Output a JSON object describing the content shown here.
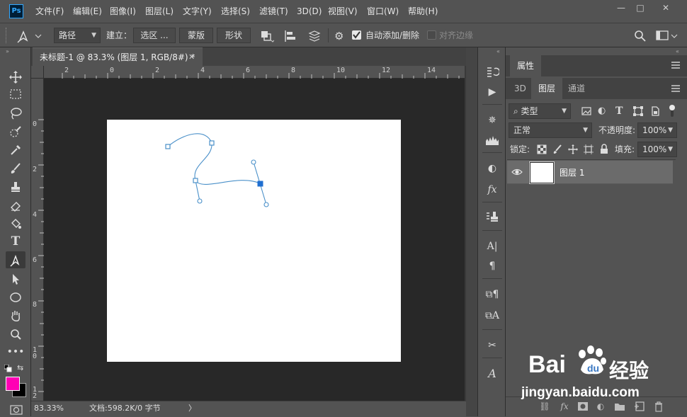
{
  "menubar": {
    "app_icon": "Ps",
    "items": [
      "文件(F)",
      "编辑(E)",
      "图像(I)",
      "图层(L)",
      "文字(Y)",
      "选择(S)",
      "滤镜(T)",
      "3D(D)",
      "视图(V)",
      "窗口(W)",
      "帮助(H)"
    ],
    "window_controls": {
      "minimize": "—",
      "restore": "□",
      "close": "✕"
    }
  },
  "options": {
    "tool_icon": "pen-icon",
    "mode": "路径",
    "make_label": "建立：",
    "selection_btn": "选区 ...",
    "mask_btn": "蒙版",
    "shape_btn": "形状",
    "auto_add_delete": "自动添加/删除",
    "auto_add_checked": true,
    "align_edges": "对齐边缘"
  },
  "document": {
    "tab_title": "未标题-1 @ 83.3% (图层 1, RGB/8#) *",
    "ruler_h": [
      "2",
      "0",
      "2",
      "4",
      "6",
      "8",
      "10",
      "12",
      "14"
    ],
    "ruler_v": [
      "0",
      "2",
      "4",
      "6",
      "8",
      "10",
      "12"
    ]
  },
  "status": {
    "zoom": "83.33%",
    "doc_info": "文档:598.2K/0 字节"
  },
  "colors": {
    "foreground": "#ff00b4",
    "background": "#000000",
    "path": "#4a90c9",
    "anchor_selected": "#1f6fd1"
  },
  "panels": {
    "properties_tab": "属性",
    "tabs": [
      "3D",
      "图层",
      "通道"
    ],
    "active_tab": "图层",
    "filter_kind": "类型",
    "blend_mode": "正常",
    "opacity_label": "不透明度:",
    "opacity_value": "100%",
    "lock_label": "锁定:",
    "fill_label": "填充:",
    "fill_value": "100%",
    "layer_name": "图层 1"
  },
  "watermark": {
    "brand": "Bai",
    "brand_suffix": "经验",
    "url": "jingyan.baidu.com"
  }
}
